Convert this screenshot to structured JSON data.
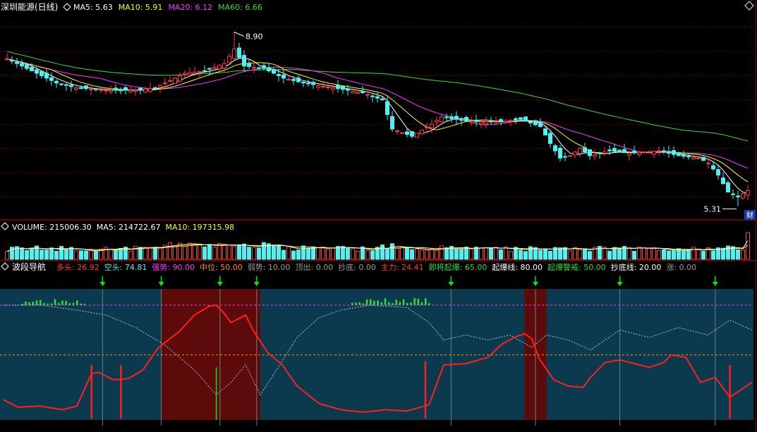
{
  "colors": {
    "up": "#ff3b3b",
    "down": "#4ff2f2",
    "ma5": "#ffffff",
    "ma10": "#ffff00",
    "ma20": "#ff33ff",
    "ma60": "#33dd33",
    "grid": "#7a0000",
    "panel_bg": "#0b3a4e",
    "band": "#5c0a0a",
    "main_line": "#ff1f1f",
    "sub_line": "#9fc6d6",
    "orange": "#ff8c1a",
    "magenta": "#ff33ff",
    "green_arrow": "#00ee00",
    "label_grey": "#9a9a9a"
  },
  "price_panel": {
    "icon": "diamond-icon",
    "title": "深圳能源(日线)",
    "indicators": [
      {
        "label": "MA5: 5.63",
        "color": "#ffffff"
      },
      {
        "label": "MA10: 5.91",
        "color": "#ffff00"
      },
      {
        "label": "MA20: 6.12",
        "color": "#ff33ff"
      },
      {
        "label": "MA60: 6.66",
        "color": "#33dd33"
      }
    ],
    "high_label": "8.90",
    "low_label": "5.31",
    "badge": "财",
    "corner_icon": "diamond-icon"
  },
  "volume_panel": {
    "icon": "diamond-icon",
    "indicators": [
      {
        "label": "VOLUME: 215006.30",
        "color": "#ffffff"
      },
      {
        "label": "MA5: 214722.67",
        "color": "#ffffff"
      },
      {
        "label": "MA10: 197315.98",
        "color": "#ffff00"
      }
    ]
  },
  "nav_panel": {
    "icon": "diamond-icon",
    "title": "波段导航",
    "indicators": [
      {
        "label": "多头: 26.92",
        "color": "#ff3b3b"
      },
      {
        "label": "空头: 74.81",
        "color": "#4ff2f2"
      },
      {
        "label": "强势: 90.00",
        "color": "#ff33ff"
      },
      {
        "label": "中位: 50.00",
        "color": "#ff8c1a"
      },
      {
        "label": "弱势: 10.00",
        "color": "#9a9a9a"
      },
      {
        "label": "顶出: 0.00",
        "color": "#9a9a9a"
      },
      {
        "label": "抄底: 0.00",
        "color": "#9a9a9a"
      },
      {
        "label": "主力: 24.41",
        "color": "#ff3b3b"
      },
      {
        "label": "即将起爆: 65.00",
        "color": "#33dd33"
      },
      {
        "label": "起爆线: 80.00",
        "color": "#ffffff"
      },
      {
        "label": "起爆警戒: 50.00",
        "color": "#33dd33"
      },
      {
        "label": "抄底线: 20.00",
        "color": "#ffffff"
      },
      {
        "label": "涨: 0.00",
        "color": "#9a9a9a"
      }
    ]
  },
  "chart_data": [
    {
      "type": "candlestick",
      "title": "深圳能源(日线)",
      "ylim": [
        5.2,
        9.3
      ],
      "annotations": {
        "high": 8.9,
        "low": 5.31
      },
      "anchors_close": [
        [
          0,
          8.35
        ],
        [
          6,
          8.05
        ],
        [
          10,
          7.85
        ],
        [
          14,
          7.75
        ],
        [
          20,
          7.7
        ],
        [
          26,
          7.7
        ],
        [
          30,
          7.75
        ],
        [
          36,
          8.05
        ],
        [
          40,
          8.1
        ],
        [
          44,
          8.25
        ],
        [
          46,
          8.55
        ],
        [
          48,
          8.2
        ],
        [
          52,
          8.15
        ],
        [
          56,
          7.95
        ],
        [
          60,
          7.85
        ],
        [
          66,
          7.75
        ],
        [
          72,
          7.65
        ],
        [
          76,
          7.5
        ],
        [
          78,
          6.9
        ],
        [
          82,
          6.75
        ],
        [
          86,
          7.0
        ],
        [
          88,
          7.15
        ],
        [
          94,
          7.05
        ],
        [
          100,
          7.05
        ],
        [
          104,
          7.1
        ],
        [
          108,
          6.95
        ],
        [
          110,
          6.6
        ],
        [
          112,
          6.3
        ],
        [
          114,
          6.35
        ],
        [
          116,
          6.5
        ],
        [
          118,
          6.35
        ],
        [
          122,
          6.45
        ],
        [
          126,
          6.4
        ],
        [
          132,
          6.45
        ],
        [
          136,
          6.35
        ],
        [
          140,
          6.3
        ],
        [
          142,
          6.2
        ],
        [
          144,
          5.95
        ],
        [
          146,
          5.6
        ],
        [
          148,
          5.5
        ],
        [
          150,
          5.63
        ]
      ],
      "series": [
        {
          "name": "MA5",
          "color": "#ffffff"
        },
        {
          "name": "MA10",
          "color": "#ffff00"
        },
        {
          "name": "MA20",
          "color": "#ff33ff"
        },
        {
          "name": "MA60",
          "color": "#33dd33"
        }
      ]
    },
    {
      "type": "bar",
      "title": "VOLUME",
      "ylim": [
        0,
        500000
      ],
      "values_sample": [
        268000,
        215006
      ],
      "series": [
        {
          "name": "MA5",
          "color": "#ffffff"
        },
        {
          "name": "MA10",
          "color": "#ffff00"
        }
      ]
    },
    {
      "type": "line",
      "title": "波段导航",
      "ylim": [
        0,
        100
      ],
      "reference_lines": [
        {
          "name": "强势",
          "value": 90,
          "color": "#ff33ff"
        },
        {
          "name": "中位",
          "value": 50,
          "color": "#ff8c1a"
        }
      ],
      "band_ranges": [
        [
          43,
          70
        ],
        [
          142,
          148
        ]
      ],
      "arrow_positions": [
        27,
        43,
        59,
        69,
        122,
        145,
        168,
        194
      ],
      "main_anchors": [
        [
          0,
          14
        ],
        [
          4,
          8
        ],
        [
          10,
          9
        ],
        [
          16,
          6
        ],
        [
          20,
          9
        ],
        [
          24,
          35
        ],
        [
          26,
          36
        ],
        [
          30,
          30
        ],
        [
          34,
          31
        ],
        [
          38,
          38
        ],
        [
          42,
          55
        ],
        [
          44,
          60
        ],
        [
          48,
          69
        ],
        [
          52,
          82
        ],
        [
          56,
          89
        ],
        [
          58,
          90
        ],
        [
          60,
          84
        ],
        [
          62,
          76
        ],
        [
          66,
          82
        ],
        [
          68,
          70
        ],
        [
          72,
          52
        ],
        [
          76,
          42
        ],
        [
          80,
          25
        ],
        [
          86,
          11
        ],
        [
          92,
          6
        ],
        [
          98,
          4
        ],
        [
          104,
          6
        ],
        [
          110,
          5
        ],
        [
          116,
          10
        ],
        [
          120,
          42
        ],
        [
          126,
          43
        ],
        [
          132,
          48
        ],
        [
          136,
          59
        ],
        [
          140,
          65
        ],
        [
          142,
          67
        ],
        [
          144,
          63
        ],
        [
          146,
          47
        ],
        [
          150,
          30
        ],
        [
          154,
          25
        ],
        [
          158,
          24
        ],
        [
          160,
          32
        ],
        [
          164,
          44
        ],
        [
          168,
          46
        ],
        [
          172,
          43
        ],
        [
          176,
          40
        ],
        [
          180,
          44
        ],
        [
          182,
          50
        ],
        [
          186,
          48
        ],
        [
          190,
          28
        ],
        [
          194,
          32
        ],
        [
          198,
          16
        ],
        [
          204,
          28
        ]
      ],
      "sub_anchors": [
        [
          0,
          90
        ],
        [
          10,
          90
        ],
        [
          20,
          86
        ],
        [
          28,
          82
        ],
        [
          36,
          72
        ],
        [
          44,
          58
        ],
        [
          52,
          38
        ],
        [
          58,
          18
        ],
        [
          62,
          28
        ],
        [
          66,
          42
        ],
        [
          68,
          30
        ],
        [
          70,
          18
        ],
        [
          74,
          36
        ],
        [
          80,
          64
        ],
        [
          86,
          80
        ],
        [
          92,
          86
        ],
        [
          100,
          90
        ],
        [
          110,
          88
        ],
        [
          116,
          76
        ],
        [
          120,
          62
        ],
        [
          126,
          66
        ],
        [
          132,
          62
        ],
        [
          138,
          66
        ],
        [
          144,
          56
        ],
        [
          148,
          66
        ],
        [
          154,
          62
        ],
        [
          160,
          54
        ],
        [
          168,
          70
        ],
        [
          176,
          64
        ],
        [
          184,
          72
        ],
        [
          192,
          66
        ],
        [
          198,
          78
        ],
        [
          204,
          70
        ]
      ],
      "series": [
        {
          "name": "多头",
          "color": "#ff1f1f"
        },
        {
          "name": "空头",
          "color": "#9fc6d6"
        }
      ]
    }
  ]
}
